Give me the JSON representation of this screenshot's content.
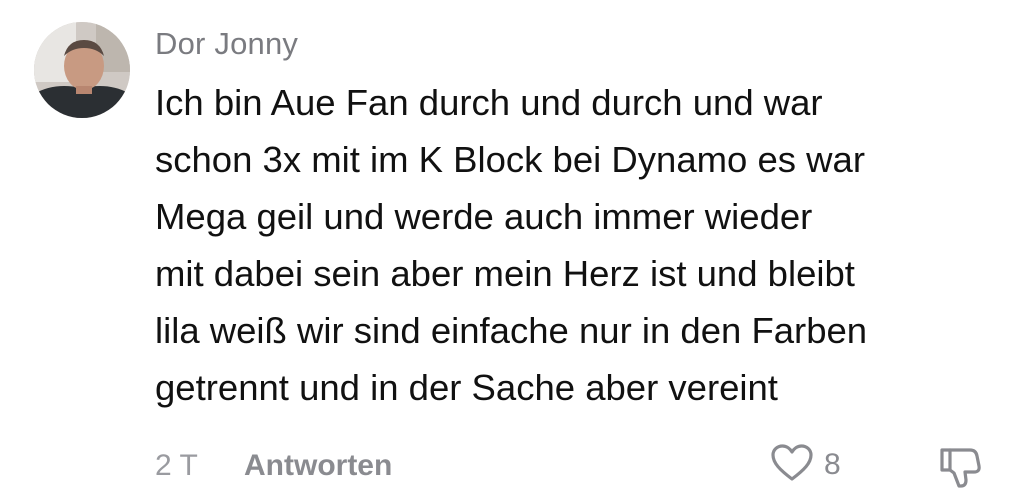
{
  "comment": {
    "username": "Dor Jonny",
    "text_lines": [
      "Ich bin Aue Fan durch und durch und war",
      "schon 3x mit im K Block bei Dynamo es war",
      "Mega geil und werde auch immer wieder",
      "mit dabei sein aber mein Herz ist und bleibt",
      "lila weiß wir sind einfache nur in den Farben",
      "getrennt und in der Sache aber vereint"
    ],
    "time": "2 T",
    "reply_label": "Antworten",
    "like_count": "8",
    "icons": {
      "like": "heart-outline-icon",
      "dislike": "thumbs-down-outline-icon"
    }
  },
  "colors": {
    "username": "#7a7b80",
    "text": "#111111",
    "meta": "#9a9ba0",
    "icon": "#8a8b90"
  }
}
